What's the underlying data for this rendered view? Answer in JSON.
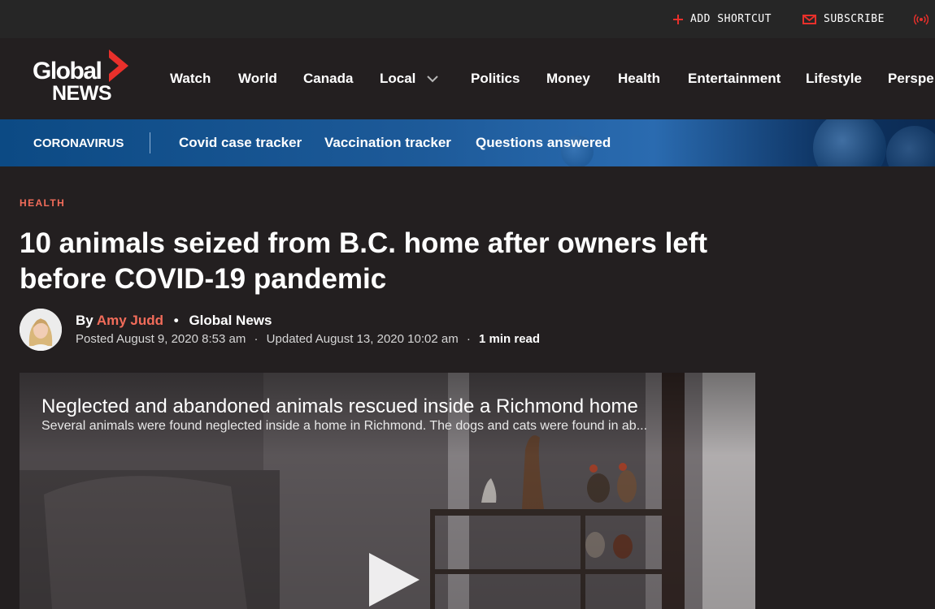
{
  "utility": {
    "add_shortcut": "ADD SHORTCUT",
    "subscribe": "SUBSCRIBE",
    "icons": [
      "plus-icon",
      "mail-icon",
      "live-broadcast-icon"
    ]
  },
  "brand": {
    "logo_top": "Global",
    "logo_bottom": "NEWS",
    "accent": "#e8302b"
  },
  "nav": {
    "items": [
      "Watch",
      "World",
      "Canada",
      "Local",
      "Politics",
      "Money",
      "Health",
      "Entertainment",
      "Lifestyle",
      "Perspe"
    ]
  },
  "covid_bar": {
    "section": "CORONAVIRUS",
    "links": [
      "Covid case tracker",
      "Vaccination tracker",
      "Questions answered"
    ]
  },
  "article": {
    "category": "HEALTH",
    "headline": "10 animals seized from B.C. home after owners left before COVID-19 pandemic",
    "by": "By",
    "author": "Amy Judd",
    "outlet": "Global News",
    "posted": "Posted August 9, 2020 8:53 am",
    "updated": "Updated August 13, 2020 10:02 am",
    "read_time": "1 min read"
  },
  "video": {
    "title": "Neglected and abandoned animals rescued inside a Richmond home",
    "description": "Several animals were found neglected inside a home in Richmond. The dogs and cats were found in ab..."
  }
}
